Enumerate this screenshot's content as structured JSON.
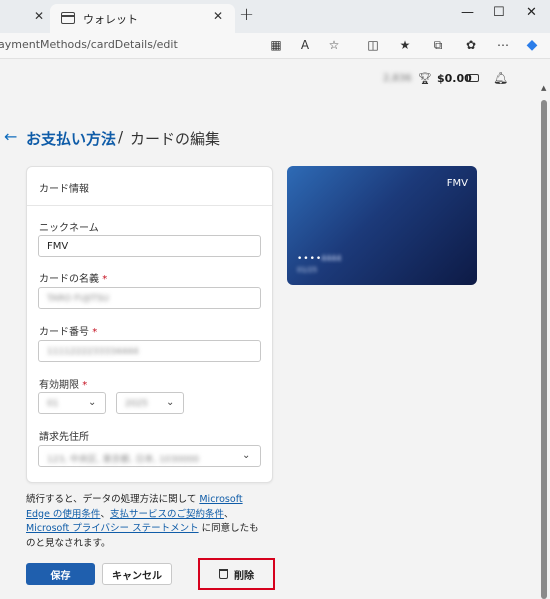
{
  "browser": {
    "active_tab_title": "ウォレット",
    "url": "aymentMethods/cardDetails/edit",
    "close_glyph": "✕",
    "new_tab_glyph": "+",
    "window_controls": {
      "minimize": "—",
      "maximize": "☐",
      "close": "✕"
    },
    "toolbar_icons": [
      "reading-view-icon",
      "read-aloud-icon",
      "favorite-star-icon",
      "split-screen-icon",
      "favorites-icon",
      "collections-icon",
      "extensions-icon",
      "more-icon",
      "copilot-icon"
    ]
  },
  "header": {
    "reward_points": "2,836",
    "balance": "$0.00"
  },
  "breadcrumb": {
    "back_glyph": "←",
    "link": "お支払い方法",
    "separator": "/",
    "current": "カードの編集"
  },
  "card_info": {
    "title": "カード情報",
    "nickname_label": "ニックネーム",
    "nickname_value": "FMV",
    "card_name_label": "カードの名義",
    "card_name_value": "TARO FUJITSU",
    "card_number_label": "カード番号",
    "card_number_value": "1111222233334444",
    "expiry_label": "有効期限",
    "expiry_month": "01",
    "expiry_year": "2025",
    "billing_label": "請求先住所",
    "billing_value": "123, 中央区, 東京都, 日本, 1030000",
    "required_mark": "*"
  },
  "card_preview": {
    "name": "FMV",
    "dots": "••••",
    "last_digits": "4444",
    "expiry": "01/25",
    "gradient": [
      "#2e6bb6",
      "#1c3a7a",
      "#0d1a45"
    ]
  },
  "consent": {
    "prefix": "続行すると、データの処理方法に関して ",
    "link1": "Microsoft Edge の使用条件",
    "sep1": "、",
    "link2": "支払サービスのご契約条件",
    "sep2": "、",
    "link3": "Microsoft プライバシー ステートメント",
    "suffix": " に同意したものと見なされます。"
  },
  "actions": {
    "save": "保存",
    "cancel": "キャンセル",
    "delete": "削除"
  },
  "colors": {
    "accent": "#0f5ca8",
    "primary_button": "#1f5fae",
    "highlight": "#d6001c",
    "required": "#c50f1f"
  }
}
